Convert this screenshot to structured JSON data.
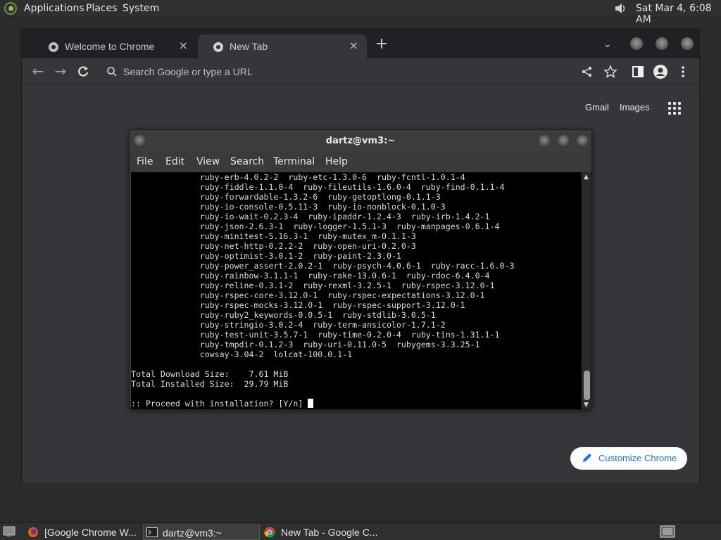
{
  "top_panel": {
    "menus": [
      "Applications",
      "Places",
      "System"
    ],
    "clock": "Sat Mar  4,  6:08 AM"
  },
  "chrome": {
    "tabs": [
      {
        "title": "Welcome to Chrome",
        "close": "×"
      },
      {
        "title": "New Tab",
        "close": "×"
      }
    ],
    "new_tab": "+",
    "omnibox_placeholder": "Search Google or type a URL",
    "links": {
      "gmail": "Gmail",
      "images": "Images"
    },
    "customize_label": "Customize Chrome"
  },
  "terminal": {
    "title": "dartz@vm3:~",
    "menu": [
      "File",
      "Edit",
      "View",
      "Search",
      "Terminal",
      "Help"
    ],
    "lines": [
      "              ruby-erb-4.0.2-2  ruby-etc-1.3.0-6  ruby-fcntl-1.0.1-4",
      "              ruby-fiddle-1.1.0-4  ruby-fileutils-1.6.0-4  ruby-find-0.1.1-4",
      "              ruby-forwardable-1.3.2-6  ruby-getoptlong-0.1.1-3",
      "              ruby-io-console-0.5.11-3  ruby-io-nonblock-0.1.0-3",
      "              ruby-io-wait-0.2.3-4  ruby-ipaddr-1.2.4-3  ruby-irb-1.4.2-1",
      "              ruby-json-2.6.3-1  ruby-logger-1.5.1-3  ruby-manpages-0.6.1-4",
      "              ruby-minitest-5.16.3-1  ruby-mutex_m-0.1.1-3",
      "              ruby-net-http-0.2.2-2  ruby-open-uri-0.2.0-3",
      "              ruby-optimist-3.0.1-2  ruby-paint-2.3.0-1",
      "              ruby-power_assert-2.0.2-1  ruby-psych-4.0.6-1  ruby-racc-1.6.0-3",
      "              ruby-rainbow-3.1.1-1  ruby-rake-13.0.6-1  ruby-rdoc-6.4.0-4",
      "              ruby-reline-0.3.1-2  ruby-rexml-3.2.5-1  ruby-rspec-3.12.0-1",
      "              ruby-rspec-core-3.12.0-1  ruby-rspec-expectations-3.12.0-1",
      "              ruby-rspec-mocks-3.12.0-1  ruby-rspec-support-3.12.0-1",
      "              ruby-ruby2_keywords-0.0.5-1  ruby-stdlib-3.0.5-1",
      "              ruby-stringio-3.0.2-4  ruby-term-ansicolor-1.7.1-2",
      "              ruby-test-unit-3.5.7-1  ruby-time-0.2.0-4  ruby-tins-1.31.1-1",
      "              ruby-tmpdir-0.1.2-3  ruby-uri-0.11.0-5  rubygems-3.3.25-1",
      "              cowsay-3.04-2  lolcat-100.0.1-1",
      "",
      "Total Download Size:    7.61 MiB",
      "Total Installed Size:  29.79 MiB",
      "",
      ":: Proceed with installation? [Y/n] "
    ]
  },
  "taskbar": {
    "items": [
      {
        "label": "[Google Chrome W..."
      },
      {
        "label": "dartz@vm3:~"
      },
      {
        "label": "New Tab - Google C..."
      }
    ]
  }
}
